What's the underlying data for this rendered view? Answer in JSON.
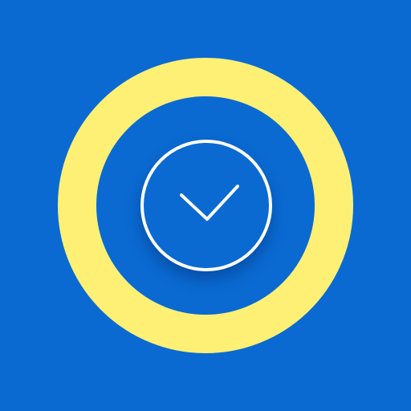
{
  "app": {
    "colors": {
      "background": "#0a6ad2",
      "ring": "#fdf075",
      "check": "#ffffff"
    },
    "icons": [
      "ring-icon",
      "check-circle-icon",
      "checkmark-icon"
    ]
  }
}
